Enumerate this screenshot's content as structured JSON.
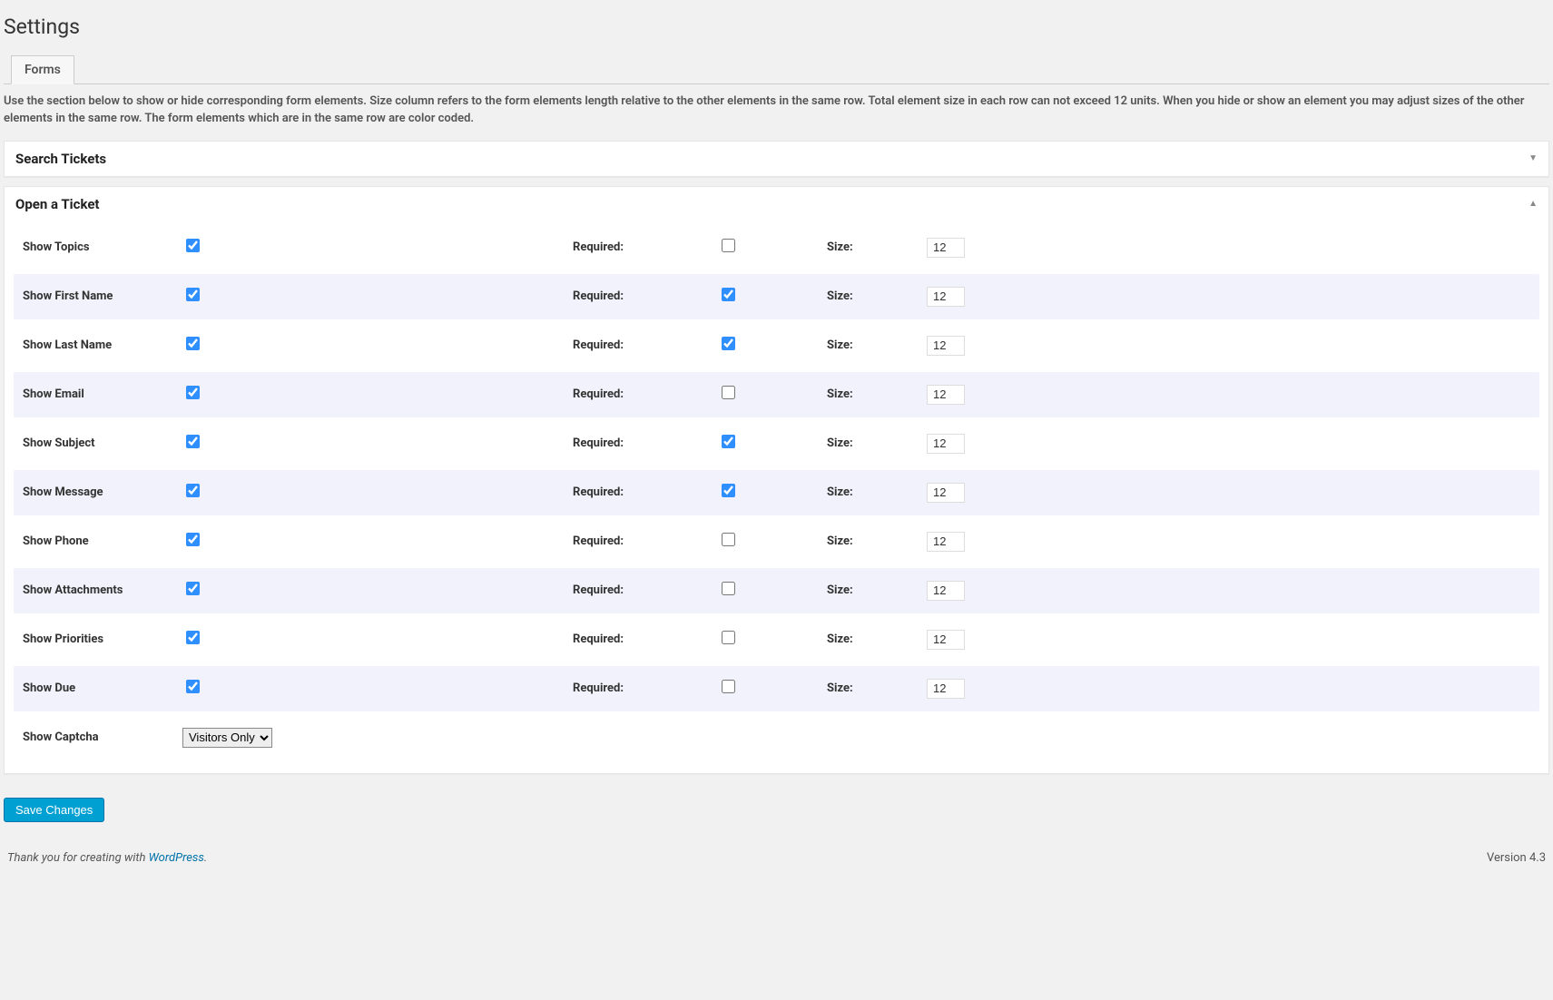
{
  "page": {
    "title": "Settings",
    "tab_label": "Forms",
    "description": "Use the section below to show or hide corresponding form elements. Size column refers to the form elements length relative to the other elements in the same row. Total element size in each row can not exceed 12 units. When you hide or show an element you may adjust sizes of the other elements in the same row. The form elements which are in the same row are color coded."
  },
  "sections": {
    "search": {
      "title": "Search Tickets",
      "open": false
    },
    "open_ticket": {
      "title": "Open a Ticket",
      "open": true
    }
  },
  "columns": {
    "required": "Required:",
    "size": "Size:"
  },
  "rows": [
    {
      "key": "topics",
      "label": "Show Topics",
      "show": true,
      "required": false,
      "size": "12",
      "tint": false
    },
    {
      "key": "first-name",
      "label": "Show First Name",
      "show": true,
      "required": true,
      "size": "12",
      "tint": true
    },
    {
      "key": "last-name",
      "label": "Show Last Name",
      "show": true,
      "required": true,
      "size": "12",
      "tint": false
    },
    {
      "key": "email",
      "label": "Show Email",
      "show": true,
      "required": false,
      "size": "12",
      "tint": true
    },
    {
      "key": "subject",
      "label": "Show Subject",
      "show": true,
      "required": true,
      "size": "12",
      "tint": false
    },
    {
      "key": "message",
      "label": "Show Message",
      "show": true,
      "required": true,
      "size": "12",
      "tint": true
    },
    {
      "key": "phone",
      "label": "Show Phone",
      "show": true,
      "required": false,
      "size": "12",
      "tint": false
    },
    {
      "key": "attachments",
      "label": "Show Attachments",
      "show": true,
      "required": false,
      "size": "12",
      "tint": true
    },
    {
      "key": "priorities",
      "label": "Show Priorities",
      "show": true,
      "required": false,
      "size": "12",
      "tint": false
    },
    {
      "key": "due",
      "label": "Show Due",
      "show": true,
      "required": false,
      "size": "12",
      "tint": true
    }
  ],
  "captcha": {
    "label": "Show Captcha",
    "selected": "Visitors Only",
    "options": [
      "Visitors Only"
    ]
  },
  "submit": {
    "label": "Save Changes"
  },
  "footer": {
    "thanks_prefix": "Thank you for creating with ",
    "wp_link": "WordPress",
    "thanks_suffix": ".",
    "version": "Version 4.3"
  }
}
